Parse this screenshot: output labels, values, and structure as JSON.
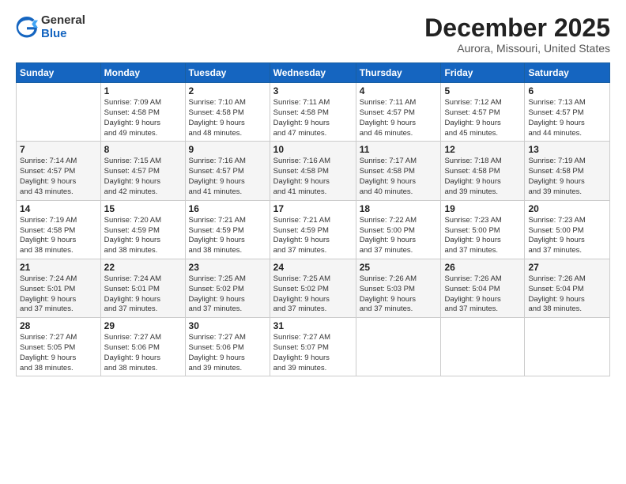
{
  "header": {
    "logo_general": "General",
    "logo_blue": "Blue",
    "title": "December 2025",
    "subtitle": "Aurora, Missouri, United States"
  },
  "calendar": {
    "days_of_week": [
      "Sunday",
      "Monday",
      "Tuesday",
      "Wednesday",
      "Thursday",
      "Friday",
      "Saturday"
    ],
    "weeks": [
      [
        {
          "day": "",
          "info": ""
        },
        {
          "day": "1",
          "info": "Sunrise: 7:09 AM\nSunset: 4:58 PM\nDaylight: 9 hours\nand 49 minutes."
        },
        {
          "day": "2",
          "info": "Sunrise: 7:10 AM\nSunset: 4:58 PM\nDaylight: 9 hours\nand 48 minutes."
        },
        {
          "day": "3",
          "info": "Sunrise: 7:11 AM\nSunset: 4:58 PM\nDaylight: 9 hours\nand 47 minutes."
        },
        {
          "day": "4",
          "info": "Sunrise: 7:11 AM\nSunset: 4:57 PM\nDaylight: 9 hours\nand 46 minutes."
        },
        {
          "day": "5",
          "info": "Sunrise: 7:12 AM\nSunset: 4:57 PM\nDaylight: 9 hours\nand 45 minutes."
        },
        {
          "day": "6",
          "info": "Sunrise: 7:13 AM\nSunset: 4:57 PM\nDaylight: 9 hours\nand 44 minutes."
        }
      ],
      [
        {
          "day": "7",
          "info": "Sunrise: 7:14 AM\nSunset: 4:57 PM\nDaylight: 9 hours\nand 43 minutes."
        },
        {
          "day": "8",
          "info": "Sunrise: 7:15 AM\nSunset: 4:57 PM\nDaylight: 9 hours\nand 42 minutes."
        },
        {
          "day": "9",
          "info": "Sunrise: 7:16 AM\nSunset: 4:57 PM\nDaylight: 9 hours\nand 41 minutes."
        },
        {
          "day": "10",
          "info": "Sunrise: 7:16 AM\nSunset: 4:58 PM\nDaylight: 9 hours\nand 41 minutes."
        },
        {
          "day": "11",
          "info": "Sunrise: 7:17 AM\nSunset: 4:58 PM\nDaylight: 9 hours\nand 40 minutes."
        },
        {
          "day": "12",
          "info": "Sunrise: 7:18 AM\nSunset: 4:58 PM\nDaylight: 9 hours\nand 39 minutes."
        },
        {
          "day": "13",
          "info": "Sunrise: 7:19 AM\nSunset: 4:58 PM\nDaylight: 9 hours\nand 39 minutes."
        }
      ],
      [
        {
          "day": "14",
          "info": "Sunrise: 7:19 AM\nSunset: 4:58 PM\nDaylight: 9 hours\nand 38 minutes."
        },
        {
          "day": "15",
          "info": "Sunrise: 7:20 AM\nSunset: 4:59 PM\nDaylight: 9 hours\nand 38 minutes."
        },
        {
          "day": "16",
          "info": "Sunrise: 7:21 AM\nSunset: 4:59 PM\nDaylight: 9 hours\nand 38 minutes."
        },
        {
          "day": "17",
          "info": "Sunrise: 7:21 AM\nSunset: 4:59 PM\nDaylight: 9 hours\nand 37 minutes."
        },
        {
          "day": "18",
          "info": "Sunrise: 7:22 AM\nSunset: 5:00 PM\nDaylight: 9 hours\nand 37 minutes."
        },
        {
          "day": "19",
          "info": "Sunrise: 7:23 AM\nSunset: 5:00 PM\nDaylight: 9 hours\nand 37 minutes."
        },
        {
          "day": "20",
          "info": "Sunrise: 7:23 AM\nSunset: 5:00 PM\nDaylight: 9 hours\nand 37 minutes."
        }
      ],
      [
        {
          "day": "21",
          "info": "Sunrise: 7:24 AM\nSunset: 5:01 PM\nDaylight: 9 hours\nand 37 minutes."
        },
        {
          "day": "22",
          "info": "Sunrise: 7:24 AM\nSunset: 5:01 PM\nDaylight: 9 hours\nand 37 minutes."
        },
        {
          "day": "23",
          "info": "Sunrise: 7:25 AM\nSunset: 5:02 PM\nDaylight: 9 hours\nand 37 minutes."
        },
        {
          "day": "24",
          "info": "Sunrise: 7:25 AM\nSunset: 5:02 PM\nDaylight: 9 hours\nand 37 minutes."
        },
        {
          "day": "25",
          "info": "Sunrise: 7:26 AM\nSunset: 5:03 PM\nDaylight: 9 hours\nand 37 minutes."
        },
        {
          "day": "26",
          "info": "Sunrise: 7:26 AM\nSunset: 5:04 PM\nDaylight: 9 hours\nand 37 minutes."
        },
        {
          "day": "27",
          "info": "Sunrise: 7:26 AM\nSunset: 5:04 PM\nDaylight: 9 hours\nand 38 minutes."
        }
      ],
      [
        {
          "day": "28",
          "info": "Sunrise: 7:27 AM\nSunset: 5:05 PM\nDaylight: 9 hours\nand 38 minutes."
        },
        {
          "day": "29",
          "info": "Sunrise: 7:27 AM\nSunset: 5:06 PM\nDaylight: 9 hours\nand 38 minutes."
        },
        {
          "day": "30",
          "info": "Sunrise: 7:27 AM\nSunset: 5:06 PM\nDaylight: 9 hours\nand 39 minutes."
        },
        {
          "day": "31",
          "info": "Sunrise: 7:27 AM\nSunset: 5:07 PM\nDaylight: 9 hours\nand 39 minutes."
        },
        {
          "day": "",
          "info": ""
        },
        {
          "day": "",
          "info": ""
        },
        {
          "day": "",
          "info": ""
        }
      ]
    ]
  }
}
